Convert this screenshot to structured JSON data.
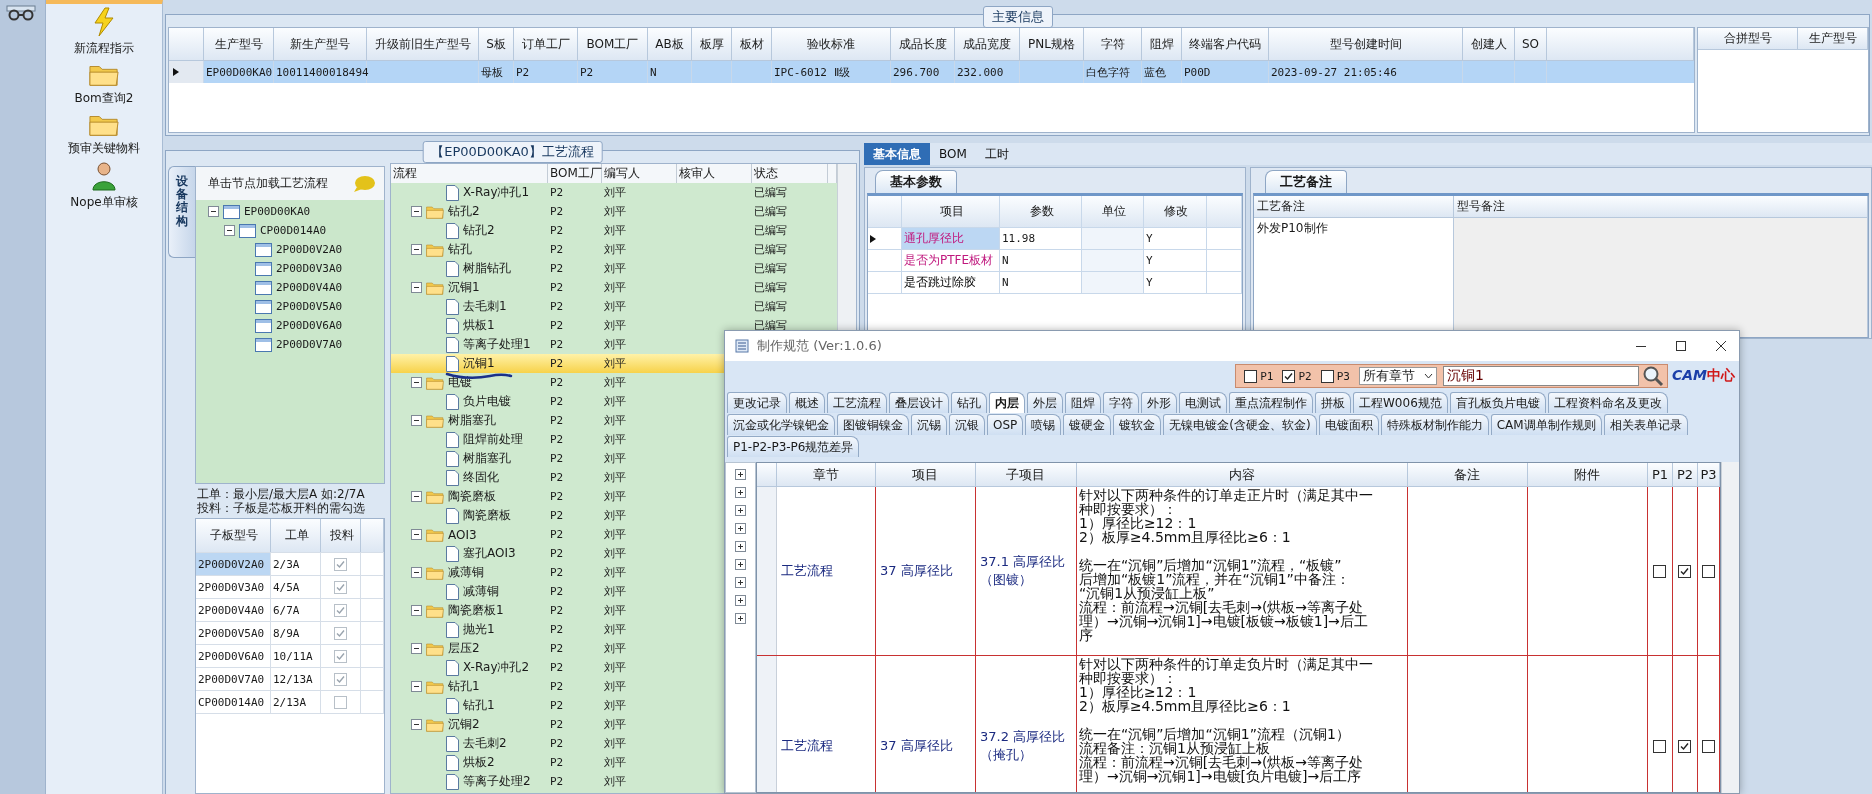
{
  "nav": {
    "items": [
      {
        "label": "新流程指示",
        "kind": "lightning"
      },
      {
        "label": "Bom查询2",
        "kind": "folder"
      },
      {
        "label": "预审关键物料",
        "kind": "folder"
      },
      {
        "label": "Nope单审核",
        "kind": "person"
      }
    ]
  },
  "main_info": {
    "title": "主要信息",
    "columns": [
      "生产型号",
      "新生产型号",
      "升级前旧生产型号",
      "S板",
      "订单工厂",
      "BOM工厂",
      "AB板",
      "板厚",
      "板材",
      "验收标准",
      "成品长度",
      "成品宽度",
      "PNL规格",
      "字符",
      "阻焊",
      "终端客户代码",
      "型号创建时间",
      "创建人",
      "SO"
    ],
    "rows": [
      {
        "selected": true,
        "cells": [
          "EP00D00KA0",
          "10011400018494",
          null,
          "母板",
          "P2",
          "P2",
          "N",
          null,
          null,
          "IPC-6012 Ⅱ级",
          "296.700",
          "232.000",
          null,
          "白色字符",
          "蓝色",
          "P00D",
          "2023-09-27 21:05:46",
          null,
          null
        ]
      }
    ],
    "side_columns": [
      "合拼型号",
      "生产型号"
    ]
  },
  "process": {
    "title": "【EP00D00KA0】工艺流程",
    "side_tab": "设备结构",
    "tree_hint": "单击节点加载工艺流程",
    "tree": [
      {
        "label": "EP00D00KA0",
        "expanded": true,
        "children": [
          {
            "label": "CP00D014A0",
            "expanded": true,
            "children": [
              {
                "label": "2P00D0V2A0"
              },
              {
                "label": "2P00D0V3A0"
              },
              {
                "label": "2P00D0V4A0"
              },
              {
                "label": "2P00D0V5A0"
              },
              {
                "label": "2P00D0V6A0"
              },
              {
                "label": "2P00D0V7A0"
              }
            ]
          }
        ]
      }
    ],
    "note_lines": [
      "工单：最小层/最大层A 如:2/7A",
      "投料：子板是芯板开料的需勾选"
    ],
    "sub_table": {
      "columns": [
        "子板型号",
        "工单",
        "投料"
      ],
      "rows": [
        {
          "board": "2P00D0V2A0",
          "order": "2/3A",
          "checked": true,
          "selected": true
        },
        {
          "board": "2P00D0V3A0",
          "order": "4/5A",
          "checked": true,
          "selected": false
        },
        {
          "board": "2P00D0V4A0",
          "order": "6/7A",
          "checked": true,
          "selected": false
        },
        {
          "board": "2P00D0V5A0",
          "order": "8/9A",
          "checked": true,
          "selected": false
        },
        {
          "board": "2P00D0V6A0",
          "order": "10/11A",
          "checked": true,
          "selected": false
        },
        {
          "board": "2P00D0V7A0",
          "order": "12/13A",
          "checked": true,
          "selected": false
        },
        {
          "board": "CP00D014A0",
          "order": "2/13A",
          "checked": false,
          "selected": false
        }
      ]
    },
    "flow_columns": [
      "流程",
      "BOM工厂",
      "编写人",
      "核审人",
      "状态"
    ],
    "flow_rows": [
      {
        "label": "X-Ray冲孔1",
        "kind": "step",
        "bom": "P2",
        "writer": "刘平",
        "status": "已编写",
        "selected": false
      },
      {
        "label": "钻孔2",
        "kind": "group",
        "expanded": true,
        "bom": "P2",
        "writer": "刘平",
        "status": "已编写",
        "selected": false,
        "children": [
          {
            "label": "钻孔2",
            "kind": "step",
            "bom": "P2",
            "writer": "刘平",
            "status": "已编写",
            "selected": false
          }
        ]
      },
      {
        "label": "钻孔",
        "kind": "group",
        "expanded": true,
        "bom": "P2",
        "writer": "刘平",
        "status": "已编写",
        "selected": false,
        "children": [
          {
            "label": "树脂钻孔",
            "kind": "step",
            "bom": "P2",
            "writer": "刘平",
            "status": "已编写",
            "selected": false
          }
        ]
      },
      {
        "label": "沉铜1",
        "kind": "group",
        "expanded": true,
        "bom": "P2",
        "writer": "刘平",
        "status": "已编写",
        "selected": false,
        "children": [
          {
            "label": "去毛刺1",
            "kind": "step",
            "bom": "P2",
            "writer": "刘平",
            "status": "已编写",
            "selected": false
          },
          {
            "label": "烘板1",
            "kind": "step",
            "bom": "P2",
            "writer": "刘平",
            "status": "已编写",
            "selected": false
          },
          {
            "label": "等离子处理1",
            "kind": "step",
            "bom": "P2",
            "writer": "刘平",
            "selected": false
          },
          {
            "label": "沉铜1",
            "kind": "step",
            "bom": "P2",
            "writer": "刘平",
            "selected": true
          }
        ]
      },
      {
        "label": "电镀",
        "kind": "group",
        "expanded": true,
        "bom": "P2",
        "writer": "刘平",
        "selected": false,
        "children": [
          {
            "label": "负片电镀",
            "kind": "step",
            "bom": "P2",
            "writer": "刘平",
            "selected": false
          }
        ]
      },
      {
        "label": "树脂塞孔",
        "kind": "group",
        "expanded": true,
        "bom": "P2",
        "writer": "刘平",
        "selected": false,
        "children": [
          {
            "label": "阻焊前处理",
            "kind": "step",
            "bom": "P2",
            "writer": "刘平",
            "selected": false
          },
          {
            "label": "树脂塞孔",
            "kind": "step",
            "bom": "P2",
            "writer": "刘平",
            "selected": false
          },
          {
            "label": "终固化",
            "kind": "step",
            "bom": "P2",
            "writer": "刘平",
            "selected": false
          }
        ]
      },
      {
        "label": "陶瓷磨板",
        "kind": "group",
        "expanded": true,
        "bom": "P2",
        "writer": "刘平",
        "selected": false,
        "children": [
          {
            "label": "陶瓷磨板",
            "kind": "step",
            "bom": "P2",
            "writer": "刘平",
            "selected": false
          }
        ]
      },
      {
        "label": "AOI3",
        "kind": "group",
        "expanded": true,
        "bom": "P2",
        "writer": "刘平",
        "selected": false,
        "children": [
          {
            "label": "塞孔AOI3",
            "kind": "step",
            "bom": "P2",
            "writer": "刘平",
            "selected": false
          }
        ]
      },
      {
        "label": "减薄铜",
        "kind": "group",
        "expanded": true,
        "bom": "P2",
        "writer": "刘平",
        "selected": false,
        "children": [
          {
            "label": "减薄铜",
            "kind": "step",
            "bom": "P2",
            "writer": "刘平",
            "selected": false
          }
        ]
      },
      {
        "label": "陶瓷磨板1",
        "kind": "group",
        "expanded": true,
        "bom": "P2",
        "writer": "刘平",
        "selected": false,
        "children": [
          {
            "label": "抛光1",
            "kind": "step",
            "bom": "P2",
            "writer": "刘平",
            "selected": false
          }
        ]
      },
      {
        "label": "层压2",
        "kind": "group",
        "expanded": true,
        "bom": "P2",
        "writer": "刘平",
        "selected": false,
        "children": [
          {
            "label": "X-Ray冲孔2",
            "kind": "step",
            "bom": "P2",
            "writer": "刘平",
            "selected": false
          }
        ]
      },
      {
        "label": "钻孔1",
        "kind": "group",
        "expanded": true,
        "bom": "P2",
        "writer": "刘平",
        "selected": false,
        "children": [
          {
            "label": "钻孔1",
            "kind": "step",
            "bom": "P2",
            "writer": "刘平",
            "selected": false
          }
        ]
      },
      {
        "label": "沉铜2",
        "kind": "group",
        "expanded": true,
        "bom": "P2",
        "writer": "刘平",
        "selected": false,
        "children": [
          {
            "label": "去毛刺2",
            "kind": "step",
            "bom": "P2",
            "writer": "刘平",
            "selected": false
          },
          {
            "label": "烘板2",
            "kind": "step",
            "bom": "P2",
            "writer": "刘平",
            "selected": false
          },
          {
            "label": "等离子处理2",
            "kind": "step",
            "bom": "P2",
            "writer": "刘平",
            "selected": false
          }
        ]
      }
    ]
  },
  "right_tabs": [
    {
      "label": "基本信息",
      "selected": true
    },
    {
      "label": "BOM",
      "selected": false
    },
    {
      "label": "工时",
      "selected": false
    }
  ],
  "basic_params": {
    "tab": "基本参数",
    "columns": [
      "项目",
      "参数",
      "单位",
      "修改"
    ],
    "rows": [
      {
        "item": "通孔厚径比",
        "value": "11.98",
        "modify": "Y",
        "highlighted": true,
        "selected": true
      },
      {
        "item": "是否为PTFE板材",
        "value": "N",
        "modify": "Y",
        "highlighted": true,
        "selected": false
      },
      {
        "item": "是否跳过除胶",
        "value": "N",
        "modify": "Y",
        "highlighted": false,
        "selected": false
      }
    ]
  },
  "process_notes": {
    "tab": "工艺备注",
    "columns": [
      "工艺备注",
      "型号备注"
    ],
    "note": "外发P10制作"
  },
  "dialog": {
    "title": "制作规范 (Ver:1.0.6)",
    "filters": [
      {
        "label": "P1",
        "checked": false
      },
      {
        "label": "P2",
        "checked": true
      },
      {
        "label": "P3",
        "checked": false
      }
    ],
    "chapter_select": "所有章节",
    "search_value": "沉铜1",
    "logo": {
      "mark": "CAM",
      "text": "中心"
    },
    "tab_rows": [
      {
        "tabs": [
          {
            "label": "更改记录",
            "selected": false
          },
          {
            "label": "概述",
            "selected": false
          },
          {
            "label": "工艺流程",
            "selected": false
          },
          {
            "label": "叠层设计",
            "selected": false
          },
          {
            "label": "钻孔",
            "selected": false
          },
          {
            "label": "内层",
            "selected": true
          },
          {
            "label": "外层",
            "selected": false
          },
          {
            "label": "阻焊",
            "selected": false
          },
          {
            "label": "字符",
            "selected": false
          },
          {
            "label": "外形",
            "selected": false
          },
          {
            "label": "电测试",
            "selected": false
          },
          {
            "label": "重点流程制作",
            "selected": false
          },
          {
            "label": "拼板",
            "selected": false
          },
          {
            "label": "工程W006规范",
            "selected": false
          },
          {
            "label": "盲孔板负片电镀",
            "selected": false
          },
          {
            "label": "工程资料命名及更改",
            "selected": false
          }
        ]
      },
      {
        "tabs": [
          {
            "label": "沉金或化学镍钯金",
            "selected": false
          },
          {
            "label": "图镀铜镍金",
            "selected": false
          },
          {
            "label": "沉锡",
            "selected": false
          },
          {
            "label": "沉银",
            "selected": false
          },
          {
            "label": "OSP",
            "selected": false
          },
          {
            "label": "喷锡",
            "selected": false
          },
          {
            "label": "镀硬金",
            "selected": false
          },
          {
            "label": "镀软金",
            "selected": false
          },
          {
            "label": "无镍电镀金(含硬金、软金)",
            "selected": false
          },
          {
            "label": "电镀面积",
            "selected": false
          },
          {
            "label": "特殊板材制作能力",
            "selected": false
          },
          {
            "label": "CAM调单制作规则",
            "selected": false
          },
          {
            "label": "相关表单记录",
            "selected": false
          }
        ]
      },
      {
        "tabs": [
          {
            "label": "P1-P2-P3-P6规范差异",
            "selected": false
          }
        ]
      }
    ],
    "table": {
      "columns": [
        "章节",
        "项目",
        "子项目",
        "内容",
        "备注",
        "附件",
        "P1",
        "P2",
        "P3"
      ],
      "rows": [
        {
          "chapter": "工艺流程",
          "item": "37 高厚径比",
          "sub_item": "37.1 高厚径比（图镀）",
          "content": [
            [
              "针对以下两种条件的订单走正片时（满足其中一",
              "种即按要求）：",
              "1）厚径比≥12：1",
              "2）板厚≥4.5mm且厚径比≥6：1"
            ],
            [
              "统一在“沉铜”后增加“沉铜1”流程，“板镀”",
              "后增加“板镀1”流程，并在“沉铜1”中备注：",
              "“沉铜1从预浸缸上板”",
              "流程：前流程→沉铜[去毛刺→(烘板→等离子处",
              "理）→沉铜→沉铜1]→电镀[板镀→板镀1]→后工",
              "序"
            ]
          ],
          "checked": [
            false,
            true,
            false
          ]
        },
        {
          "chapter": "工艺流程",
          "item": "37 高厚径比",
          "sub_item": "37.2 高厚径比（掩孔）",
          "content": [
            [
              "针对以下两种条件的订单走负片时（满足其中一",
              "种即按要求）：",
              "1）厚径比≥12：1",
              "2）板厚≥4.5mm且厚径比≥6：1"
            ],
            [
              "统一在“沉铜”后增加“沉铜1”流程（沉铜1）",
              "流程备注：沉铜1从预浸缸上板",
              "流程：前流程→沉铜[去毛刺→(烘板→等离子处",
              "理）→沉铜→沉铜1]→电镀[负片电镀]→后工序"
            ]
          ],
          "checked": [
            false,
            true,
            false
          ]
        }
      ]
    }
  }
}
